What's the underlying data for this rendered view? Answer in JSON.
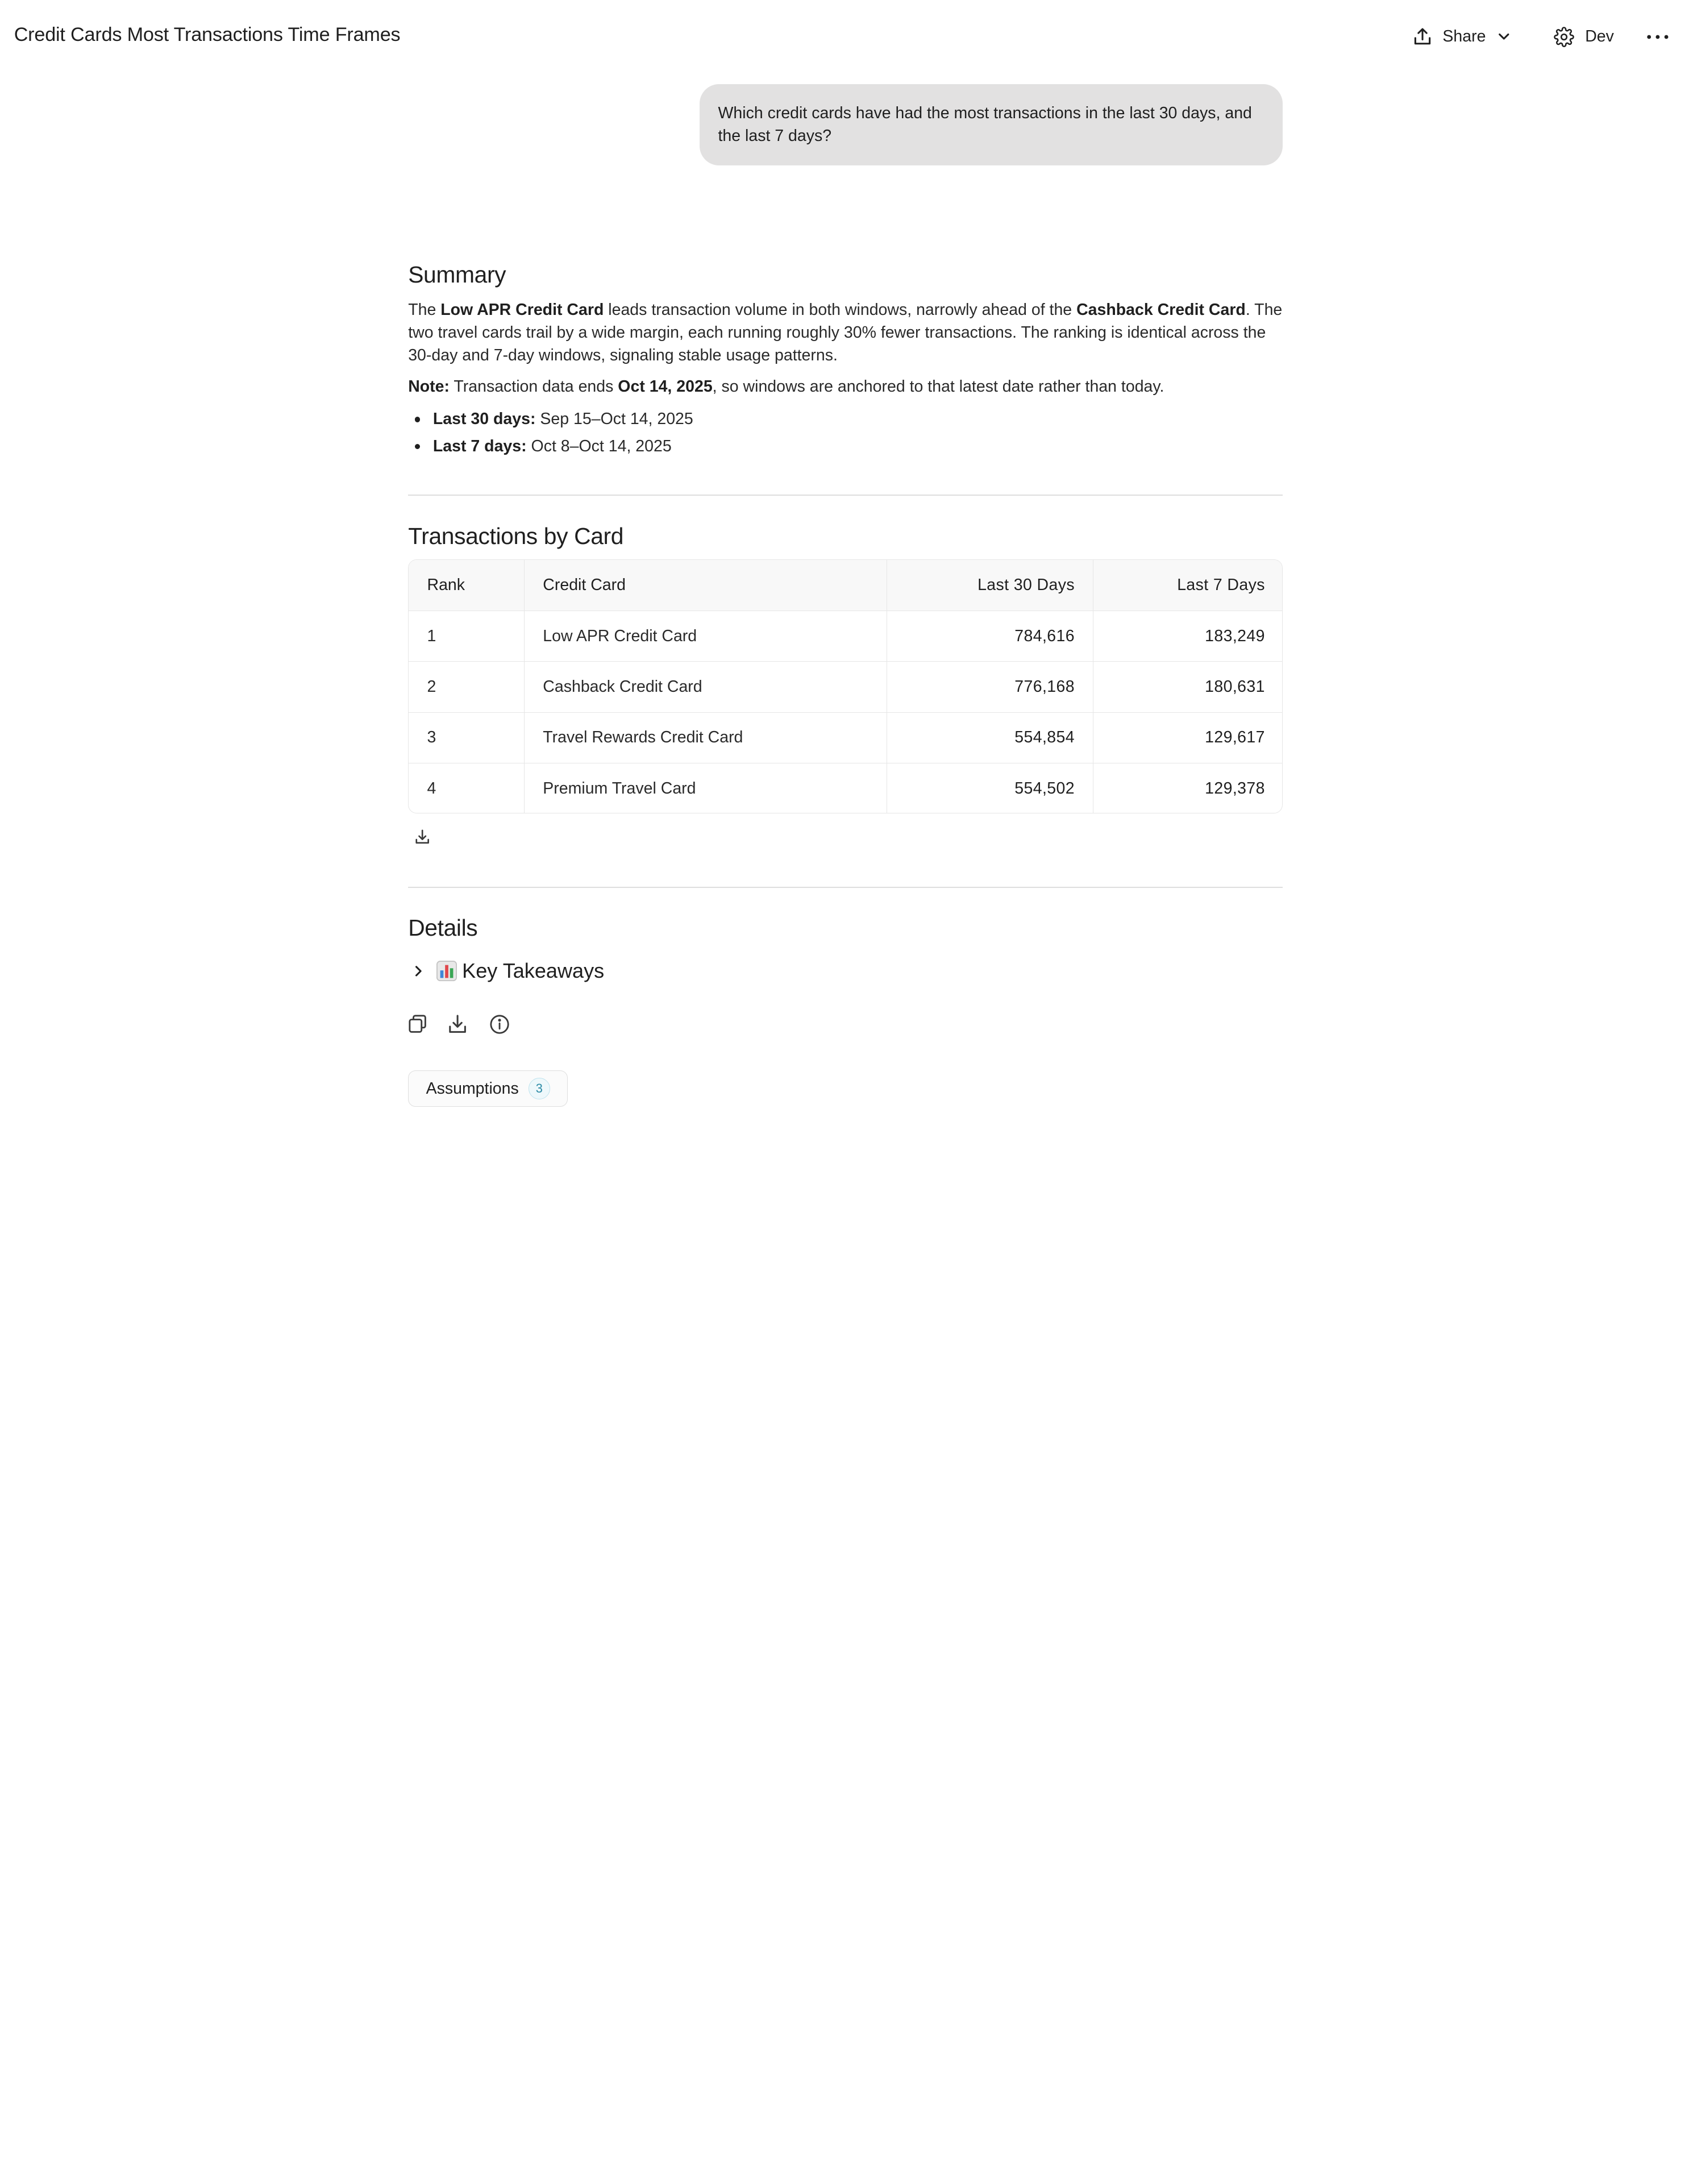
{
  "page": {
    "title": "Credit Cards Most Transactions Time Frames"
  },
  "header": {
    "share_label": "Share",
    "dev_label": "Dev"
  },
  "chat": {
    "user_message": "Which credit cards have had the most transactions in the last 30 days, and the last 7 days?"
  },
  "summary": {
    "heading": "Summary",
    "p1_a": "The ",
    "p1_b": "Low APR Credit Card",
    "p1_c": " leads transaction volume in both windows, narrowly ahead of the ",
    "p1_d": "Cashback Credit Card",
    "p1_e": ". The two travel cards trail by a wide margin, each running roughly 30% fewer transactions. The ranking is identical across the 30-day and 7-day windows, signaling stable usage patterns.",
    "note_label": "Note:",
    "note_a": " Transaction data ends ",
    "note_date": "Oct 14, 2025",
    "note_b": ", so windows are anchored to that latest date rather than today.",
    "bullets": [
      {
        "label": "Last 30 days:",
        "value": " Sep 15–Oct 14, 2025"
      },
      {
        "label": "Last 7 days:",
        "value": " Oct 8–Oct 14, 2025"
      }
    ]
  },
  "transactions": {
    "heading": "Transactions by Card",
    "columns": [
      "Rank",
      "Credit Card",
      "Last 30 Days",
      "Last 7 Days"
    ],
    "rows": [
      {
        "rank": "1",
        "card": "Low APR Credit Card",
        "d30": "784,616",
        "d7": "183,249"
      },
      {
        "rank": "2",
        "card": "Cashback Credit Card",
        "d30": "776,168",
        "d7": "180,631"
      },
      {
        "rank": "3",
        "card": "Travel Rewards Credit Card",
        "d30": "554,854",
        "d7": "129,617"
      },
      {
        "rank": "4",
        "card": "Premium Travel Card",
        "d30": "554,502",
        "d7": "129,378"
      }
    ]
  },
  "details": {
    "heading": "Details",
    "takeaways_label": "Key Takeaways",
    "assumptions_label": "Assumptions",
    "assumptions_count": "3"
  },
  "icons": {
    "share": "upload-icon",
    "share_menu": "chevron-down-icon",
    "dev": "gear-icon",
    "more": "more-horizontal-icon",
    "table_download": "download-icon",
    "takeaways_toggle": "chevron-right-icon",
    "takeaways_emoji": "bar-chart-icon",
    "copy": "copy-icon",
    "download": "download-icon",
    "info": "info-icon"
  },
  "colors": {
    "bubble_bg": "#e2e1e1",
    "table_header_bg": "#f8f8f8",
    "badge_text": "#2b8aa5"
  }
}
